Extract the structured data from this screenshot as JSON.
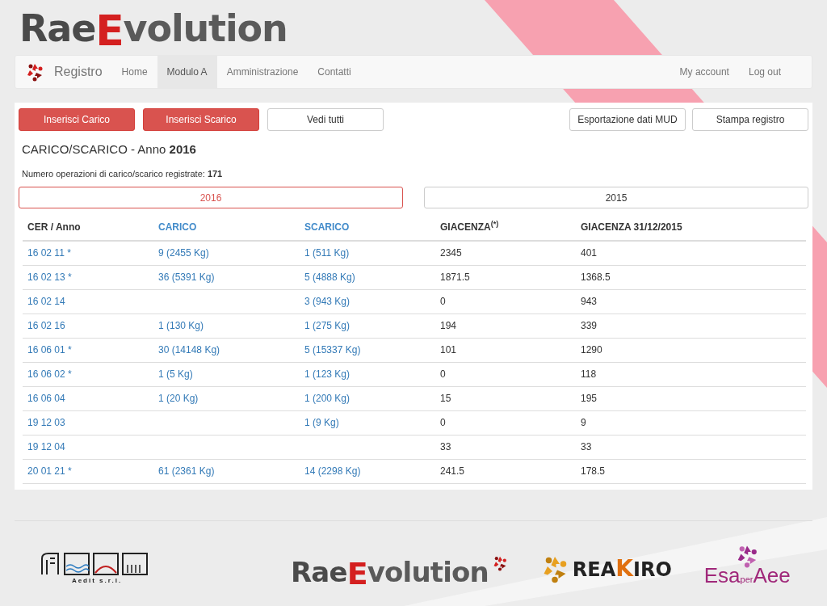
{
  "logo": {
    "parts": [
      "Rae",
      "E",
      "volution"
    ]
  },
  "navbar": {
    "brand": "Registro",
    "items": [
      {
        "label": "Home",
        "selected": false
      },
      {
        "label": "Modulo A",
        "selected": true
      },
      {
        "label": "Amministrazione",
        "selected": false
      },
      {
        "label": "Contatti",
        "selected": false
      }
    ],
    "right_items": [
      "My account",
      "Log out"
    ]
  },
  "toolbar": {
    "left": [
      {
        "label": "Inserisci Carico",
        "kind": "primary"
      },
      {
        "label": "Inserisci Scarico",
        "kind": "primary"
      },
      {
        "label": "Vedi tutti",
        "kind": "default"
      }
    ],
    "right": [
      {
        "label": "Esportazione dati MUD",
        "kind": "default"
      },
      {
        "label": "Stampa registro",
        "kind": "default"
      }
    ]
  },
  "heading": "CARICO/SCARICO - Anno **2016**",
  "summary": "Numero operazioni di carico/scarico registrate: **171**",
  "year_tabs": [
    {
      "label": "2016",
      "selected": true
    },
    {
      "label": "2015",
      "selected": false
    }
  ],
  "table": {
    "columns": [
      {
        "label": "CER / Anno",
        "kind": "link",
        "sortable": false
      },
      {
        "label": "CARICO",
        "kind": "link",
        "sortable": true
      },
      {
        "label": "SCARICO",
        "kind": "link",
        "sortable": true
      },
      {
        "label": "GIACENZA$^{(*)}$",
        "kind": "text",
        "sortable": false
      },
      {
        "label": "GIACENZA 31/12/2015",
        "kind": "text",
        "sortable": false
      }
    ],
    "rows": [
      [
        "16 02 11 *",
        "9 (2455 Kg)",
        "1 (511 Kg)",
        "2345",
        "401"
      ],
      [
        "16 02 13 *",
        "36 (5391 Kg)",
        "5 (4888 Kg)",
        "1871.5",
        "1368.5"
      ],
      [
        "16 02 14",
        "",
        "3 (943 Kg)",
        "0",
        "943"
      ],
      [
        "16 02 16",
        "1 (130 Kg)",
        "1 (275 Kg)",
        "194",
        "339"
      ],
      [
        "16 06 01 *",
        "30 (14148 Kg)",
        "5 (15337 Kg)",
        "101",
        "1290"
      ],
      [
        "16 06 02 *",
        "1 (5 Kg)",
        "1 (123 Kg)",
        "0",
        "118"
      ],
      [
        "16 06 04",
        "1 (20 Kg)",
        "1 (200 Kg)",
        "15",
        "195"
      ],
      [
        "19 12 03",
        "",
        "1 (9 Kg)",
        "0",
        "9"
      ],
      [
        "19 12 04",
        "",
        "",
        "33",
        "33"
      ],
      [
        "20 01 21 *",
        "61 (2361 Kg)",
        "14 (2298 Kg)",
        "241.5",
        "178.5"
      ]
    ]
  },
  "footer_logos": [
    {
      "kind": "aedit",
      "text": "Aedit s.r.l."
    },
    {
      "kind": "raee",
      "parts": [
        "Rae",
        "E",
        "volution"
      ]
    },
    {
      "kind": "reakiro",
      "parts": [
        "REA",
        "K",
        "IRO"
      ]
    },
    {
      "kind": "esa",
      "parts": [
        "Esa",
        "per",
        "Aee"
      ]
    }
  ]
}
